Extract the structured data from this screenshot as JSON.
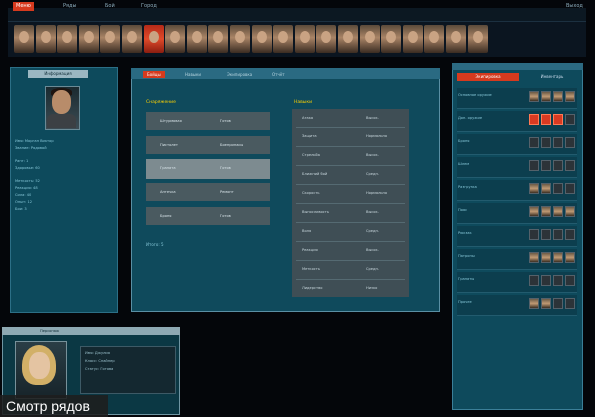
{
  "top_tabs": [
    {
      "label": "Меню"
    },
    {
      "label": "Ряды"
    },
    {
      "label": "Бой"
    },
    {
      "label": "Город"
    }
  ],
  "top_right": "Выход",
  "portraits_count": 22,
  "selected_portrait_index": 6,
  "left_panel": {
    "header": "Информация",
    "lines": [
      "Имя: Морган Виктор",
      "Звание: Рядовой",
      "Ранг: 1",
      "Здоровье: 60",
      "Меткость: 52",
      "Реакция: 48",
      "Сила: 40",
      "Опыт: 12",
      "Бои: 3"
    ]
  },
  "center_window": {
    "tabs": [
      {
        "label": "Бойцы"
      },
      {
        "label": "Навыки"
      },
      {
        "label": "Экипировка"
      },
      {
        "label": "Отчёт"
      }
    ],
    "left_section_title": "Снаряжение",
    "left_rows": [
      {
        "a": "Штурмовая",
        "b": "Готов"
      },
      {
        "a": "Пистолет",
        "b": "Боеприпасы"
      },
      {
        "a": "Граната",
        "b": "Готов"
      },
      {
        "a": "Аптечка",
        "b": "Ремонт"
      },
      {
        "a": "Броня",
        "b": "Готов"
      }
    ],
    "left_footer": "Итого: 5",
    "right_section_title": "Навыки",
    "right_rows": [
      {
        "a": "Атака",
        "b": "Высок."
      },
      {
        "a": "Защита",
        "b": "Нормально"
      },
      {
        "a": "Стрельба",
        "b": "Высок."
      },
      {
        "a": "Ближний бой",
        "b": "Средн."
      },
      {
        "a": "Скорость",
        "b": "Нормально"
      },
      {
        "a": "Выносливость",
        "b": "Высок."
      },
      {
        "a": "Воля",
        "b": "Средн."
      },
      {
        "a": "Реакция",
        "b": "Высок."
      },
      {
        "a": "Меткость",
        "b": "Средн."
      },
      {
        "a": "Лидерство",
        "b": "Низко"
      }
    ]
  },
  "right_panel": {
    "tabs": [
      {
        "label": "Экипировка"
      },
      {
        "label": "Инвентарь"
      }
    ],
    "rows": [
      {
        "label": "Основное оружие",
        "boxes": [
          "img",
          "img",
          "img",
          "img"
        ]
      },
      {
        "label": "Доп. оружие",
        "boxes": [
          "red",
          "red",
          "red",
          "empty"
        ]
      },
      {
        "label": "Броня",
        "boxes": [
          "empty",
          "empty",
          "empty",
          "empty"
        ]
      },
      {
        "label": "Шлем",
        "boxes": [
          "empty",
          "empty",
          "empty",
          "empty"
        ]
      },
      {
        "label": "Разгрузка",
        "boxes": [
          "img",
          "img",
          "empty",
          "empty"
        ]
      },
      {
        "label": "Пояс",
        "boxes": [
          "img",
          "img",
          "img",
          "img"
        ]
      },
      {
        "label": "Рюкзак",
        "boxes": [
          "empty",
          "empty",
          "empty",
          "empty"
        ]
      },
      {
        "label": "Патроны",
        "boxes": [
          "img",
          "img",
          "img",
          "img"
        ]
      },
      {
        "label": "Гранаты",
        "boxes": [
          "empty",
          "empty",
          "empty",
          "empty"
        ]
      },
      {
        "label": "Прочее",
        "boxes": [
          "img",
          "img",
          "empty",
          "empty"
        ]
      }
    ]
  },
  "bottom_preview": {
    "title": "Персонаж",
    "lines": [
      "Имя: Джулия",
      "Класс: Снайпер",
      "Статус: Готова"
    ]
  },
  "caption": "Смотр рядов",
  "colors": {
    "accent": "#d63a1e",
    "panel": "#0f4a5c",
    "highlight": "#ffd200"
  }
}
